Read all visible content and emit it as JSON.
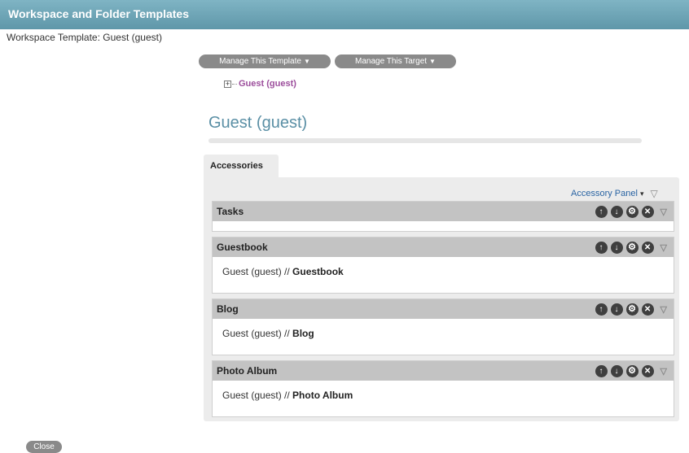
{
  "window": {
    "title": "Workspace and Folder Templates"
  },
  "subtitle": "Workspace Template: Guest (guest)",
  "menus": {
    "manage_template": "Manage This Template",
    "manage_target": "Manage This Target"
  },
  "tree": {
    "expander": "+",
    "node": "Guest (guest)"
  },
  "page_title": "Guest (guest)",
  "tab": {
    "label": "Accessories"
  },
  "accessory_panel": {
    "label": "Accessory Panel",
    "caret": "▾",
    "toggle": "▽"
  },
  "accessories": [
    {
      "title": "Tasks",
      "path": "",
      "name": ""
    },
    {
      "title": "Guestbook",
      "path": "Guest (guest) // ",
      "name": "Guestbook"
    },
    {
      "title": "Blog",
      "path": "Guest (guest) // ",
      "name": "Blog"
    },
    {
      "title": "Photo Album",
      "path": "Guest (guest) // ",
      "name": "Photo Album"
    }
  ],
  "icons": {
    "up": "↑",
    "down": "↓",
    "config": "⚙",
    "delete": "✕",
    "collapse": "▽"
  },
  "close_label": "Close",
  "colors": {
    "titlebar": "#6fa6b7",
    "link": "#2a64a3",
    "tree_node": "#9c4e9c",
    "page_title": "#5a8fa5"
  }
}
